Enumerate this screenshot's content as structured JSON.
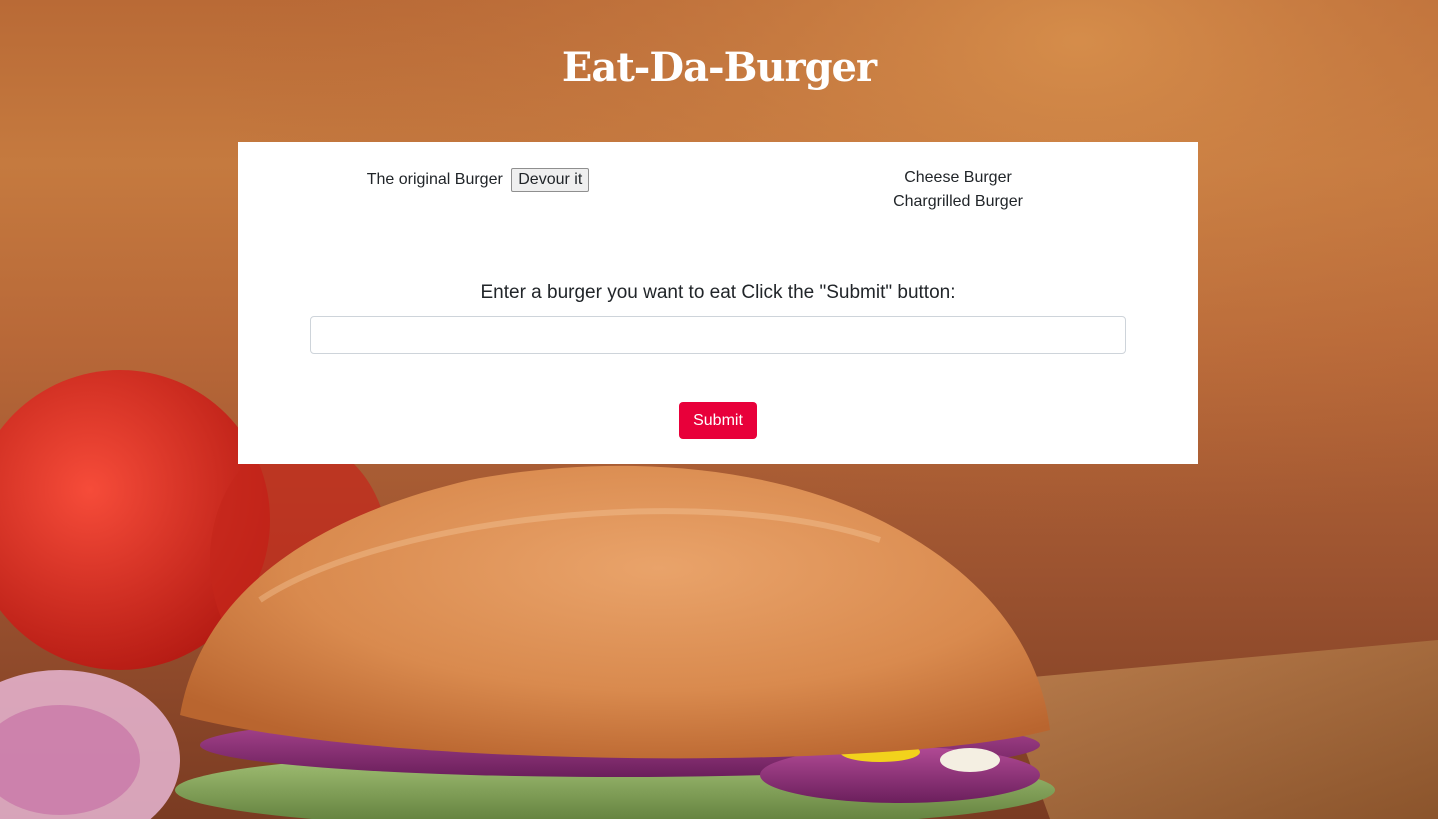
{
  "page": {
    "title": "Eat-Da-Burger"
  },
  "burgers": {
    "uneaten": [
      {
        "name": "The original Burger",
        "action_label": "Devour it"
      }
    ],
    "devoured": [
      {
        "name": "Cheese Burger"
      },
      {
        "name": "Chargrilled Burger"
      }
    ]
  },
  "form": {
    "label": "Enter a burger you want to eat Click the \"Submit\" button:",
    "input_value": "",
    "submit_label": "Submit"
  },
  "colors": {
    "submit_button": "#e8003a",
    "panel": "#ffffff",
    "title_text": "#ffffff"
  },
  "background": {
    "image": "burger-photo"
  }
}
